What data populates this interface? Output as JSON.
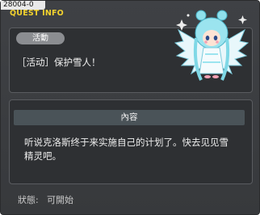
{
  "window": {
    "quest_id": "28004-0",
    "title": "QUEST INFO"
  },
  "quest": {
    "badge": "活動",
    "name": "［活动］保护雪人！"
  },
  "content": {
    "header": "內容",
    "description_line1": "听说克洛斯终于来实施自己的计划了。快去见见雪",
    "description_line2": "精灵吧。"
  },
  "status": {
    "label": "狀態:",
    "value": "可開始"
  },
  "npc": {
    "icon": "snow-spirit-sprite",
    "colors": {
      "hair": "#7fd8e6",
      "wings": "#dff4f8",
      "accent": "#f3a1b4"
    }
  }
}
